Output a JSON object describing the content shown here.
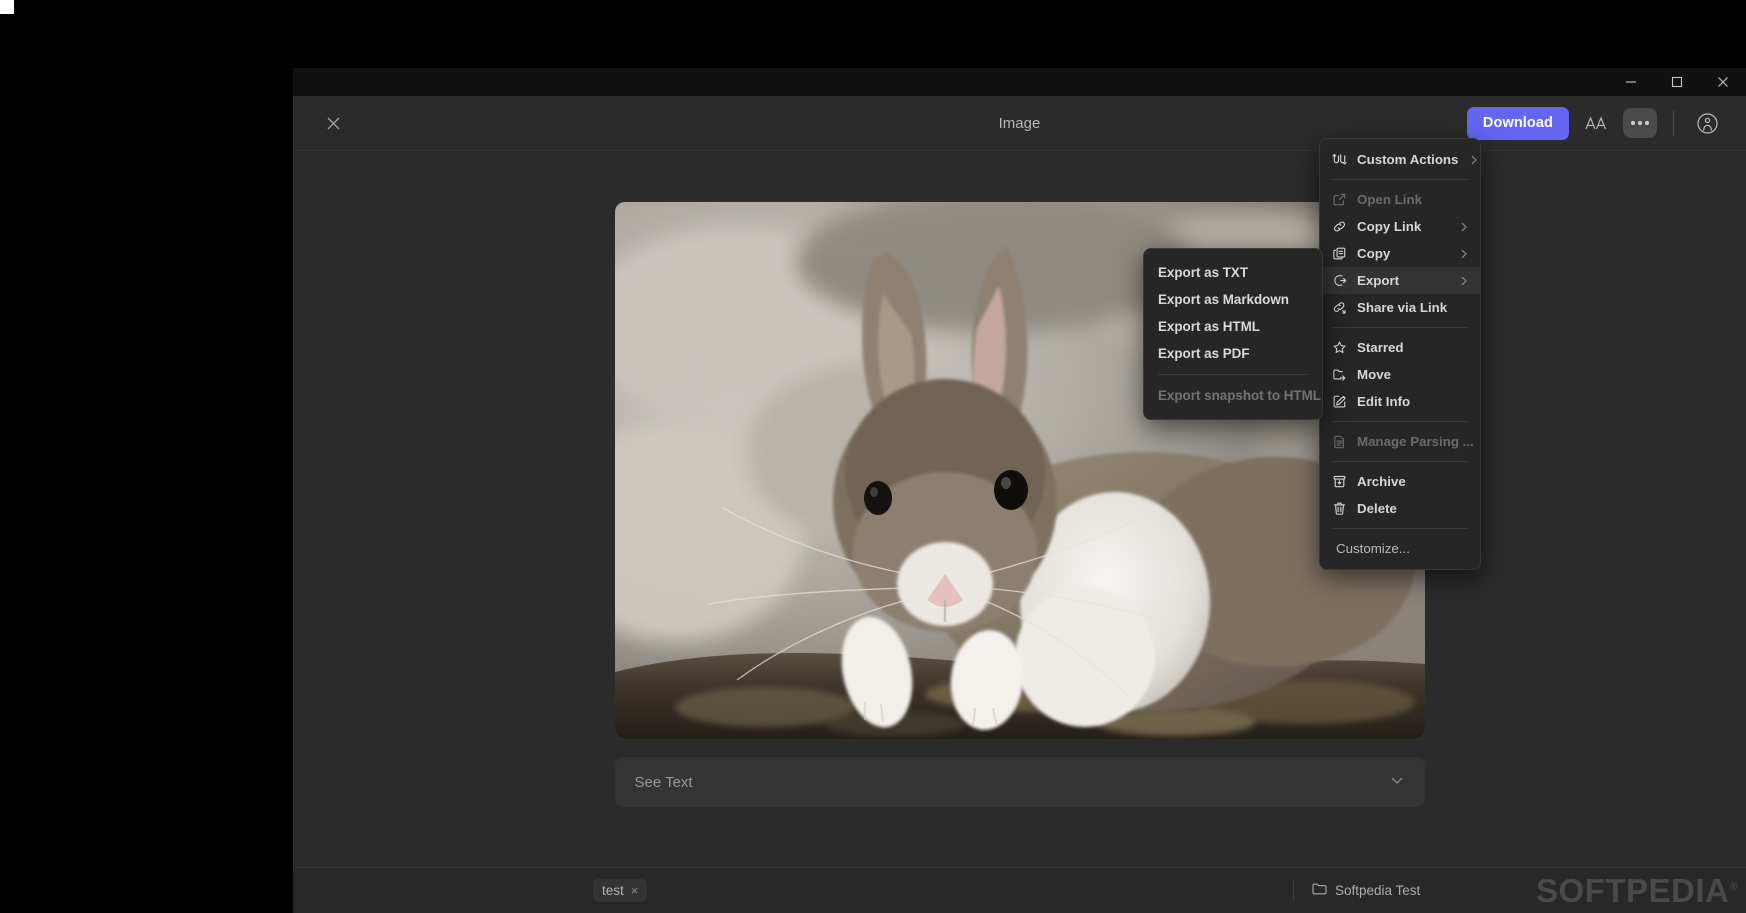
{
  "window": {
    "controls": {
      "minimize": "minimize-button",
      "maximize": "maximize-button",
      "close": "close-button"
    }
  },
  "header": {
    "close_label": "close-icon",
    "title": "Image",
    "download_label": "Download",
    "font_icon": "AA",
    "more_icon": "ellipsis-icon",
    "account_icon": "account-avatar-icon"
  },
  "main": {
    "see_text_label": "See Text",
    "image_alt": "rabbit-photo"
  },
  "footer": {
    "tag": "test",
    "tag_remove": "×",
    "folder": "Softpedia Test",
    "watermark": "SOFTPEDIA",
    "watermark_mark": "®"
  },
  "context_menu": {
    "items": [
      {
        "label": "Custom Actions",
        "icon": "custom-actions-icon",
        "submenu": true,
        "disabled": false
      },
      {
        "separator": true
      },
      {
        "label": "Open Link",
        "icon": "open-link-icon",
        "submenu": false,
        "disabled": true
      },
      {
        "label": "Copy Link",
        "icon": "copy-link-icon",
        "submenu": true,
        "disabled": false
      },
      {
        "label": "Copy",
        "icon": "copy-icon",
        "submenu": true,
        "disabled": false
      },
      {
        "label": "Export",
        "icon": "export-icon",
        "submenu": true,
        "disabled": false,
        "active": true
      },
      {
        "label": "Share via Link",
        "icon": "share-link-icon",
        "submenu": false,
        "disabled": false
      },
      {
        "separator": true
      },
      {
        "label": "Starred",
        "icon": "star-icon",
        "submenu": false,
        "disabled": false
      },
      {
        "label": "Move",
        "icon": "move-folder-icon",
        "submenu": false,
        "disabled": false
      },
      {
        "label": "Edit Info",
        "icon": "edit-info-icon",
        "submenu": false,
        "disabled": false
      },
      {
        "separator": true
      },
      {
        "label": "Manage Parsing ...",
        "icon": "document-icon",
        "submenu": false,
        "disabled": true
      },
      {
        "separator": true
      },
      {
        "label": "Archive",
        "icon": "archive-icon",
        "submenu": false,
        "disabled": false
      },
      {
        "label": "Delete",
        "icon": "trash-icon",
        "submenu": false,
        "disabled": false
      },
      {
        "separator": true
      },
      {
        "label": "Customize...",
        "icon": null,
        "submenu": false,
        "disabled": false,
        "plain": true
      }
    ]
  },
  "export_submenu": {
    "items": [
      {
        "label": "Export as TXT",
        "disabled": false
      },
      {
        "label": "Export as Markdown",
        "disabled": false
      },
      {
        "label": "Export as HTML",
        "disabled": false
      },
      {
        "label": "Export as PDF",
        "disabled": false
      },
      {
        "separator": true
      },
      {
        "label": "Export snapshot to HTML",
        "disabled": true
      }
    ]
  }
}
